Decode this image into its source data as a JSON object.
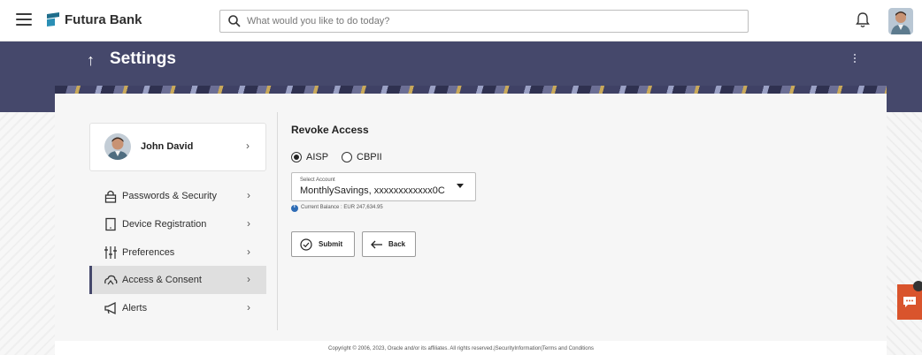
{
  "header": {
    "brand": "Futura Bank",
    "search_placeholder": "What would you like to do today?"
  },
  "page": {
    "title": "Settings",
    "back_icon": "up-arrow-icon"
  },
  "sidebar": {
    "profile_name": "John David",
    "items": [
      {
        "label": "Passwords & Security",
        "icon": "lock-icon"
      },
      {
        "label": "Device Registration",
        "icon": "device-icon"
      },
      {
        "label": "Preferences",
        "icon": "sliders-icon"
      },
      {
        "label": "Access & Consent",
        "icon": "cloud-access-icon",
        "active": true
      },
      {
        "label": "Alerts",
        "icon": "megaphone-icon"
      }
    ]
  },
  "content": {
    "section_title": "Revoke Access",
    "radio_options": [
      {
        "label": "AISP",
        "checked": true
      },
      {
        "label": "CBPII",
        "checked": false
      }
    ],
    "select": {
      "caption": "Select Account",
      "value": "MonthlySavings, xxxxxxxxxxxx0C"
    },
    "balance_text": "Current Balance : EUR 247,634.95",
    "submit_label": "Submit",
    "back_label": "Back"
  },
  "footer": {
    "text": "Copyright © 2006, 2023, Oracle and/or its affiliates. All rights reserved.|SecurityInformation|Terms and Conditions"
  },
  "colors": {
    "banner": "#45486b",
    "accent": "#45486b",
    "chat": "#d9542c",
    "info": "#2e6cb5"
  }
}
